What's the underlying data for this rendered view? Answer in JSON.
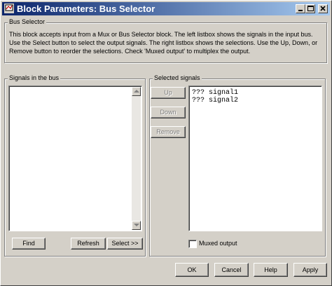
{
  "window": {
    "title": "Block Parameters: Bus Selector"
  },
  "bus_selector": {
    "legend": "Bus Selector",
    "description": "This block accepts input from a Mux or Bus Selector block. The left listbox shows the signals in the input bus. Use the Select button to select the output signals. The right listbox shows the selections. Use the Up, Down, or Remove button to reorder the selections. Check 'Muxed output' to multiplex the output."
  },
  "signals_in_bus": {
    "legend": "Signals in the bus",
    "items": [],
    "find_label": "Find",
    "refresh_label": "Refresh",
    "select_label": "Select >>"
  },
  "selected_signals": {
    "legend": "Selected signals",
    "up_label": "Up",
    "down_label": "Down",
    "remove_label": "Remove",
    "items": [
      "??? signal1",
      "??? signal2"
    ],
    "muxed_output_label": "Muxed output",
    "muxed_output_checked": false
  },
  "footer": {
    "ok_label": "OK",
    "cancel_label": "Cancel",
    "help_label": "Help",
    "apply_label": "Apply"
  }
}
